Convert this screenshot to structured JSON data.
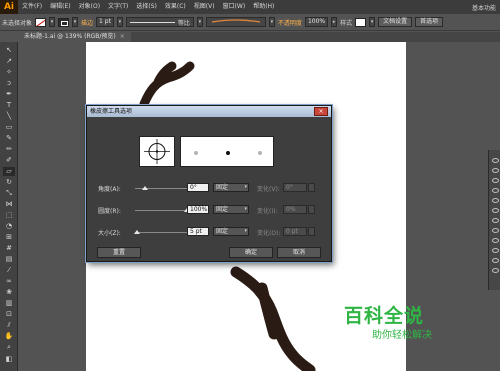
{
  "app": {
    "logo": "Ai",
    "workspace": "基本功能"
  },
  "menu": [
    "文件(F)",
    "编辑(E)",
    "对象(O)",
    "文字(T)",
    "选择(S)",
    "效果(C)",
    "视图(V)",
    "窗口(W)",
    "帮助(H)"
  ],
  "control_bar": {
    "selection": "未选择对象",
    "stroke_label": "描边",
    "stroke_weight": "1 pt",
    "profile": "等比",
    "opacity_label": "不透明度",
    "opacity_value": "100%",
    "style_label": "样式",
    "doc_setup": "文档设置",
    "preferences": "首选项"
  },
  "tab": {
    "title": "未标题-1.ai @ 139% (RGB/预览)",
    "close": "×"
  },
  "dialog": {
    "title": "橡皮擦工具选项",
    "close": "×",
    "rows": [
      {
        "label": "角度(A):",
        "value": "0°",
        "mode": "固定",
        "variation_label": "变化(V):",
        "variation": "0°",
        "slider": 0.19
      },
      {
        "label": "圆度(R):",
        "value": "100%",
        "mode": "固定",
        "variation_label": "变化(I):",
        "variation": "0%",
        "slider": 1.0
      },
      {
        "label": "大小(Z):",
        "value": "5 pt",
        "mode": "固定",
        "variation_label": "变化(O):",
        "variation": "0 pt",
        "slider": 0.04
      }
    ],
    "reset": "重置",
    "ok": "确定",
    "cancel": "取消"
  },
  "watermark": {
    "title": "百科全说",
    "subtitle": "助你轻松解决"
  },
  "colors": {
    "accent_orange": "#ff9a00",
    "watermark_green": "#2fb544",
    "dialog_border": "#7fa0c8"
  }
}
